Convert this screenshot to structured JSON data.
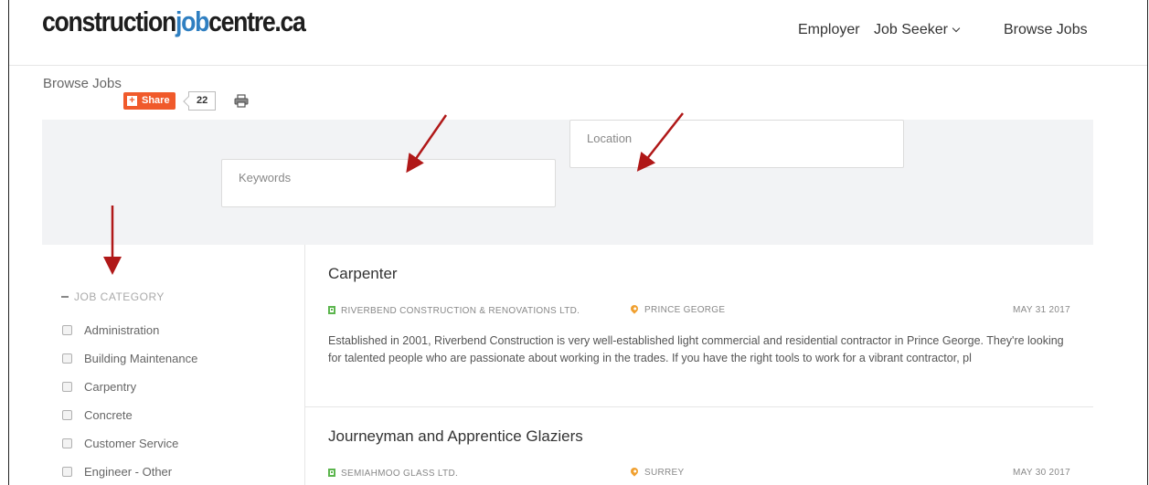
{
  "header": {
    "logo": {
      "part1": "construction",
      "part2": "job",
      "part3": "centre.ca"
    },
    "nav": {
      "employer": "Employer",
      "job_seeker": "Job Seeker",
      "browse_jobs": "Browse Jobs"
    }
  },
  "breadcrumb": "Browse Jobs",
  "share": {
    "label": "Share",
    "count": "22"
  },
  "search": {
    "keywords_placeholder": "Keywords",
    "location_placeholder": "Location"
  },
  "filters": {
    "heading": "JOB CATEGORY",
    "categories": [
      "Administration",
      "Building Maintenance",
      "Carpentry",
      "Concrete",
      "Customer Service",
      "Engineer - Other"
    ]
  },
  "jobs": [
    {
      "title": "Carpenter",
      "company": "RIVERBEND CONSTRUCTION & RENOVATIONS LTD.",
      "location": "PRINCE GEORGE",
      "date": "MAY 31 2017",
      "description": "Established in 2001, Riverbend Construction is very well-established light commercial and residential contractor in Prince George. They're looking for talented people who are passionate about working in the trades.  If you have the right tools to work for a vibrant contractor, pl"
    },
    {
      "title": "Journeyman and Apprentice Glaziers",
      "company": "SEMIAHMOO GLASS LTD.",
      "location": "SURREY",
      "date": "MAY 30 2017",
      "description": ""
    }
  ],
  "colors": {
    "accent_blue": "#2f7fc1",
    "share_orange": "#f05a2b",
    "company_icon_green": "#5bb54d",
    "location_icon_orange": "#f0a030",
    "annotation_arrow_red": "#b01818"
  }
}
